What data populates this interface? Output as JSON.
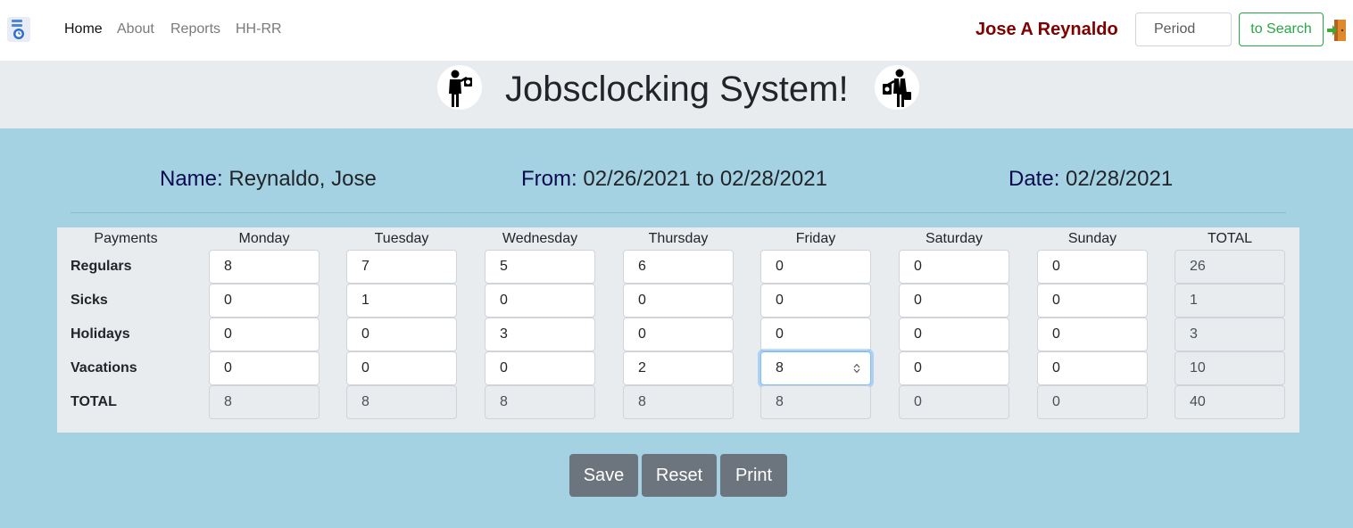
{
  "nav": {
    "links": [
      "Home",
      "About",
      "Reports",
      "HH-RR"
    ],
    "user_name": "Jose A Reynaldo",
    "period_placeholder": "Period",
    "search_label": "to Search"
  },
  "header": {
    "title": "Jobsclocking System!"
  },
  "info": {
    "name_label": "Name:",
    "name_value": "Reynaldo, Jose",
    "from_label": "From:",
    "from_value": "02/26/2021 to 02/28/2021",
    "date_label": "Date:",
    "date_value": "02/28/2021"
  },
  "table": {
    "columns": [
      "Payments",
      "Monday",
      "Tuesday",
      "Wednesday",
      "Thursday",
      "Friday",
      "Saturday",
      "Sunday",
      "TOTAL"
    ],
    "rows": [
      {
        "label": "Regulars",
        "values": [
          "8",
          "7",
          "5",
          "6",
          "0",
          "0",
          "0"
        ],
        "total": "26"
      },
      {
        "label": "Sicks",
        "values": [
          "0",
          "1",
          "0",
          "0",
          "0",
          "0",
          "0"
        ],
        "total": "1"
      },
      {
        "label": "Holidays",
        "values": [
          "0",
          "0",
          "3",
          "0",
          "0",
          "0",
          "0"
        ],
        "total": "3"
      },
      {
        "label": "Vacations",
        "values": [
          "0",
          "0",
          "0",
          "2",
          "8",
          "0",
          "0"
        ],
        "total": "10"
      }
    ],
    "total_row": {
      "label": "TOTAL",
      "values": [
        "8",
        "8",
        "8",
        "8",
        "8",
        "0",
        "0"
      ],
      "total": "40"
    }
  },
  "buttons": {
    "save": "Save",
    "reset": "Reset",
    "print": "Print"
  },
  "colors": {
    "background": "#a4d2e2",
    "user_name": "#800000",
    "search_green": "#28a745",
    "button_gray": "#6c757d"
  }
}
